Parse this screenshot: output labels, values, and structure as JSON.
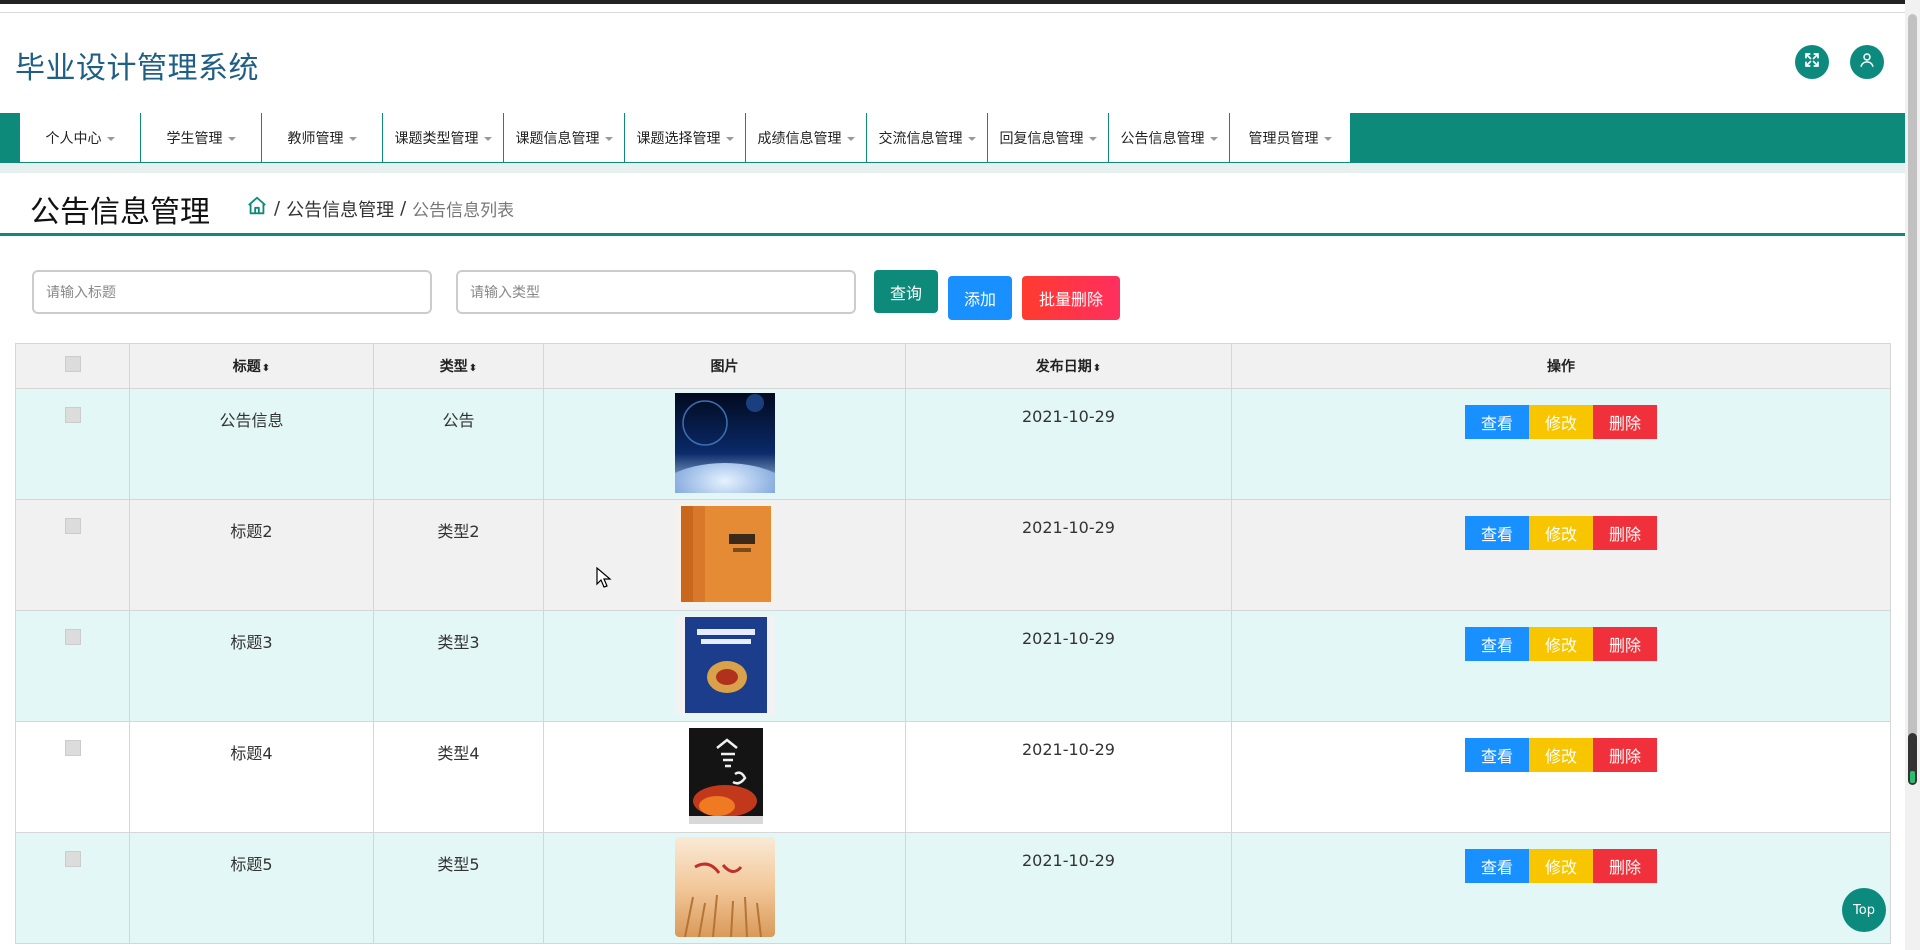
{
  "app": {
    "title": "毕业设计管理系统",
    "accent_color": "#0e8a7b",
    "title_color": "#1f5f86"
  },
  "header": {
    "fullscreen_icon": "expand-arrows-icon",
    "user_icon": "user-icon"
  },
  "nav": {
    "items": [
      {
        "label": "个人中心"
      },
      {
        "label": "学生管理"
      },
      {
        "label": "教师管理"
      },
      {
        "label": "课题类型管理"
      },
      {
        "label": "课题信息管理"
      },
      {
        "label": "课题选择管理"
      },
      {
        "label": "成绩信息管理"
      },
      {
        "label": "交流信息管理"
      },
      {
        "label": "回复信息管理"
      },
      {
        "label": "公告信息管理"
      },
      {
        "label": "管理员管理"
      }
    ]
  },
  "page": {
    "title": "公告信息管理",
    "breadcrumb": {
      "home_icon": "home-icon",
      "sep": "/",
      "level1": "公告信息管理",
      "current": "公告信息列表"
    }
  },
  "search": {
    "title_placeholder": "请输入标题",
    "type_placeholder": "请输入类型",
    "query_label": "查询",
    "add_label": "添加",
    "batch_delete_label": "批量删除"
  },
  "table": {
    "headers": {
      "title": "标题",
      "type": "类型",
      "image": "图片",
      "date": "发布日期",
      "actions": "操作"
    },
    "sort_glyph": "⬍",
    "rows": [
      {
        "title": "公告信息",
        "type": "公告",
        "date": "2021-10-29",
        "image": "space-planet-picture"
      },
      {
        "title": "标题2",
        "type": "类型2",
        "date": "2021-10-29",
        "image": "orange-book-picture"
      },
      {
        "title": "标题3",
        "type": "类型3",
        "date": "2021-10-29",
        "image": "blue-book-picture"
      },
      {
        "title": "标题4",
        "type": "类型4",
        "date": "2021-10-29",
        "image": "black-book-picture"
      },
      {
        "title": "标题5",
        "type": "类型5",
        "date": "2021-10-29",
        "image": "wheat-field-picture"
      }
    ],
    "actions": {
      "view": "查看",
      "edit": "修改",
      "delete": "删除"
    },
    "colors": {
      "view": "#1890ff",
      "edit": "#f7c600",
      "delete": "#f0303a"
    }
  },
  "back_to_top": "Top"
}
